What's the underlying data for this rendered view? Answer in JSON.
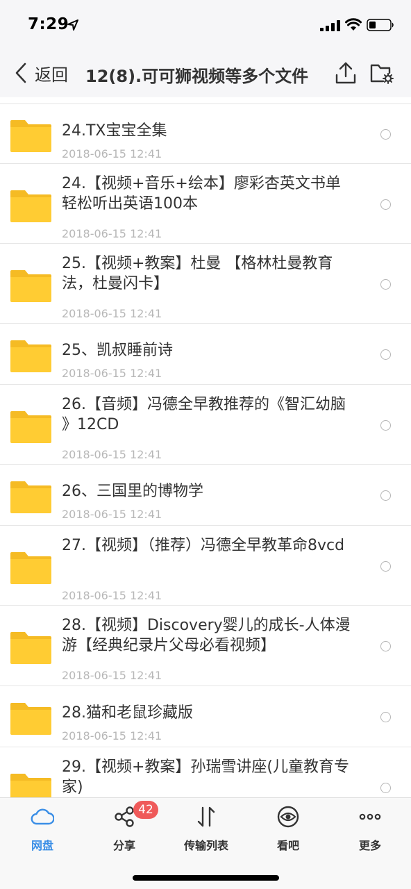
{
  "status_bar": {
    "time": "7:29"
  },
  "nav": {
    "back_label": "返回",
    "title": "12(8).可可狮视频等多个文件"
  },
  "files": [
    {
      "name": "24.TX宝宝全集",
      "date": "2018-06-15 12:41"
    },
    {
      "name": "24.【视频+音乐+绘本】廖彩杏英文书单 轻松听出英语100本",
      "date": "2018-06-15 12:41"
    },
    {
      "name": "25.【视频+教案】杜曼 【格林杜曼教育法，杜曼闪卡】",
      "date": "2018-06-15 12:41"
    },
    {
      "name": "25、凯叔睡前诗",
      "date": "2018-06-15 12:41"
    },
    {
      "name": "26.【音频】冯德全早教推荐的《智汇幼脑 》12CD",
      "date": "2018-06-15 12:41"
    },
    {
      "name": "26、三国里的博物学",
      "date": "2018-06-15 12:41"
    },
    {
      "name": "27.【视频】（推荐）冯德全早教革命8vcd",
      "date": "2018-06-15 12:41"
    },
    {
      "name": "28.【视频】Discovery婴儿的成长-人体漫游【经典纪录片父母必看视频】",
      "date": "2018-06-15 12:41"
    },
    {
      "name": "28.猫和老鼠珍藏版",
      "date": "2018-06-15 12:41"
    },
    {
      "name": "29.【视频+教案】孙瑞雪讲座(儿童教育专家)",
      "date": ""
    }
  ],
  "tabs": [
    {
      "label": "网盘",
      "icon": "cloud-icon",
      "active": true
    },
    {
      "label": "分享",
      "icon": "share-icon",
      "badge": "42"
    },
    {
      "label": "传输列表",
      "icon": "transfer-icon"
    },
    {
      "label": "看吧",
      "icon": "eye-icon"
    },
    {
      "label": "更多",
      "icon": "more-icon"
    }
  ],
  "colors": {
    "folder": "#ffcc33",
    "accent": "#3a8ee6",
    "badge": "#ef5a5a",
    "date_text": "#b7b7b7"
  }
}
